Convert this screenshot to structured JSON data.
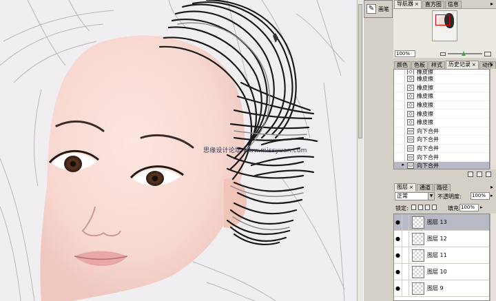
{
  "brush_panel": {
    "icon": "brush-icon",
    "label": "画笔"
  },
  "navigator": {
    "tabs": [
      {
        "label": "导航器",
        "active": true,
        "closable": true
      },
      {
        "label": "直方图",
        "active": false,
        "closable": false
      },
      {
        "label": "信息",
        "active": false,
        "closable": false
      }
    ],
    "zoom": "100%",
    "zoom_slider_level": 0.4
  },
  "history": {
    "tabs": [
      {
        "label": "颜色",
        "active": false,
        "closable": false
      },
      {
        "label": "色板",
        "active": false,
        "closable": false
      },
      {
        "label": "样式",
        "active": false,
        "closable": false
      },
      {
        "label": "历史记录",
        "active": true,
        "closable": true
      },
      {
        "label": "动作",
        "active": false,
        "closable": false
      }
    ],
    "items": [
      {
        "label": "橡皮擦",
        "icon": "eraser-icon",
        "selected": false,
        "partial": true
      },
      {
        "label": "橡皮擦",
        "icon": "eraser-icon",
        "selected": false
      },
      {
        "label": "橡皮擦",
        "icon": "eraser-icon",
        "selected": false
      },
      {
        "label": "橡皮擦",
        "icon": "eraser-icon",
        "selected": false
      },
      {
        "label": "橡皮擦",
        "icon": "eraser-icon",
        "selected": false
      },
      {
        "label": "橡皮擦",
        "icon": "eraser-icon",
        "selected": false
      },
      {
        "label": "橡皮擦",
        "icon": "eraser-icon",
        "selected": false
      },
      {
        "label": "向下合并",
        "icon": "merge-icon",
        "selected": false
      },
      {
        "label": "向下合并",
        "icon": "merge-icon",
        "selected": false
      },
      {
        "label": "向下合并",
        "icon": "merge-icon",
        "selected": false
      },
      {
        "label": "向下合并",
        "icon": "merge-icon",
        "selected": false
      },
      {
        "label": "向下合并",
        "icon": "merge-icon",
        "selected": true
      }
    ]
  },
  "layers": {
    "tabs": [
      {
        "label": "图层",
        "active": true,
        "closable": true
      },
      {
        "label": "通道",
        "active": false,
        "closable": false
      },
      {
        "label": "路径",
        "active": false,
        "closable": false
      }
    ],
    "blend_mode": "正常",
    "opacity_label": "不透明度:",
    "opacity": "100%",
    "lock_label": "锁定:",
    "fill_label": "填充:",
    "fill": "100%",
    "items": [
      {
        "name": "图层 13",
        "selected": true
      },
      {
        "name": "图层 12",
        "selected": false
      },
      {
        "name": "图层 11",
        "selected": false
      },
      {
        "name": "图层 10",
        "selected": false
      },
      {
        "name": "图层 9",
        "selected": false
      }
    ]
  },
  "canvas": {
    "watermark": "思缘设计论坛 www.missyuan.com"
  },
  "colors": {
    "selection": "#b7b9c4",
    "panel_bg": "#d4d0c8",
    "canvas_bg": "#f1eef2"
  }
}
